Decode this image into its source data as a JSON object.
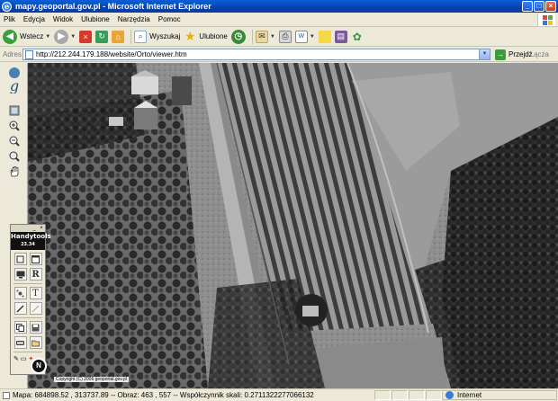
{
  "window": {
    "title": "mapy.geoportal.gov.pl - Microsoft Internet Explorer"
  },
  "menubar": {
    "items": [
      "Plik",
      "Edycja",
      "Widok",
      "Ulubione",
      "Narzędzia",
      "Pomoc"
    ]
  },
  "toolbar": {
    "back_label": "Wstecz",
    "search_label": "Wyszukaj",
    "favorites_label": "Ulubione"
  },
  "address": {
    "label": "Adres",
    "url": "http://212.244.179.188/website/Orto/viewer.htm",
    "go_label": "Przejdź",
    "links_label": "Łącza"
  },
  "map": {
    "handytools_logo": "Handytools",
    "handytools_version": "23.34",
    "north_label": "N",
    "copyright": "Copyright (C) 2006 geoportal.gov.pl"
  },
  "status": {
    "text": "Mapa: 684898.52 , 313737.89 -- Obraz: 463 , 557 -- Współczynnik skali: 0.2711322277066132",
    "zone_label": "Internet"
  },
  "colors": {
    "title_blue": "#0842b0",
    "chrome": "#ece9d8"
  }
}
